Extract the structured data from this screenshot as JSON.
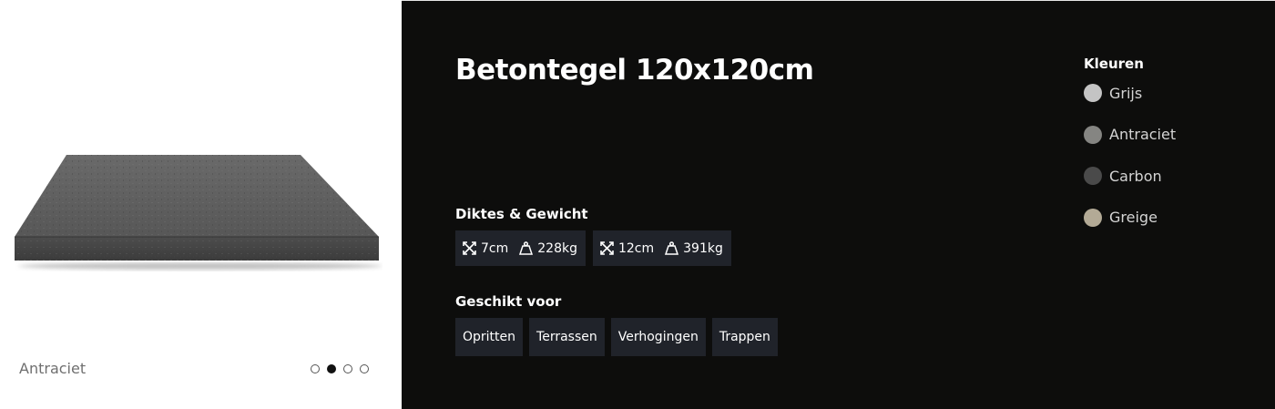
{
  "gallery": {
    "caption": "Antraciet",
    "slides": 4,
    "active_slide": 2
  },
  "product": {
    "title": "Betontegel 120x120cm"
  },
  "specs": {
    "label": "Diktes & Gewicht",
    "items": [
      {
        "thickness": "7cm",
        "weight": "228kg"
      },
      {
        "thickness": "12cm",
        "weight": "391kg"
      }
    ]
  },
  "suitable": {
    "label": "Geschikt voor",
    "tags": [
      "Opritten",
      "Terrassen",
      "Verhogingen",
      "Trappen"
    ]
  },
  "colors": {
    "label": "Kleuren",
    "options": [
      {
        "name": "Grijs",
        "hex": "#c4c4c4"
      },
      {
        "name": "Antraciet",
        "hex": "#858582"
      },
      {
        "name": "Carbon",
        "hex": "#4a4a4a"
      },
      {
        "name": "Greige",
        "hex": "#b3aa96"
      }
    ]
  },
  "theme": {
    "panel_bg": "#0d0d0c",
    "chip_bg": "#20232a"
  },
  "icons": {
    "thickness": "expand-arrows-icon",
    "weight": "weight-icon"
  }
}
